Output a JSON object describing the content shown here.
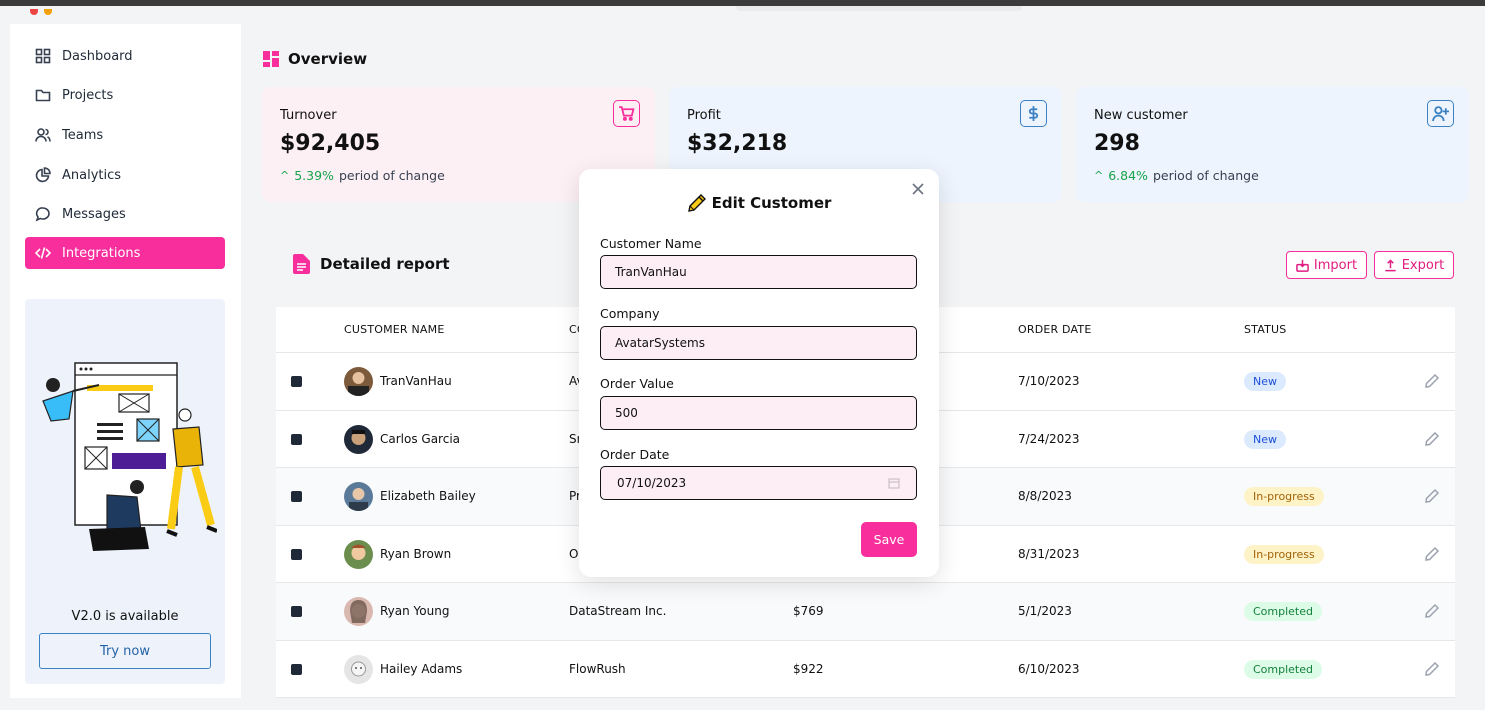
{
  "sidebar": {
    "items": [
      {
        "label": "Dashboard",
        "icon": "grid-icon"
      },
      {
        "label": "Projects",
        "icon": "folder-icon"
      },
      {
        "label": "Teams",
        "icon": "users-icon"
      },
      {
        "label": "Analytics",
        "icon": "pie-chart-icon"
      },
      {
        "label": "Messages",
        "icon": "chat-icon"
      },
      {
        "label": "Integrations",
        "icon": "code-icon",
        "active": true
      }
    ],
    "promo": {
      "text": "V2.0 is available",
      "button": "Try now"
    }
  },
  "overview": {
    "title": "Overview",
    "cards": [
      {
        "label": "Turnover",
        "value": "$92,405",
        "change": "5.39%",
        "change_text": "period of change",
        "icon": "cart-icon",
        "bg": "#fdf0f5",
        "accent": "#f72e9b"
      },
      {
        "label": "Profit",
        "value": "$32,218",
        "change": "",
        "change_text": "",
        "icon": "dollar-icon",
        "bg": "#eef4fd",
        "accent": "#3b82c4"
      },
      {
        "label": "New customer",
        "value": "298",
        "change": "6.84%",
        "change_text": "period of change",
        "icon": "user-plus-icon",
        "bg": "#eef4fd",
        "accent": "#3b82c4"
      }
    ]
  },
  "report": {
    "title": "Detailed report",
    "import_label": "Import",
    "export_label": "Export",
    "columns": [
      "CUSTOMER NAME",
      "CO",
      "ORDER DATE",
      "STATUS"
    ],
    "rows": [
      {
        "name": "TranVanHau",
        "company": "Av",
        "value": "",
        "date": "7/10/2023",
        "status": "New"
      },
      {
        "name": "Carlos Garcia",
        "company": "Sn",
        "value": "",
        "date": "7/24/2023",
        "status": "New"
      },
      {
        "name": "Elizabeth Bailey",
        "company": "Pr",
        "value": "",
        "date": "8/8/2023",
        "status": "In-progress"
      },
      {
        "name": "Ryan Brown",
        "company": "O",
        "value": "",
        "date": "8/31/2023",
        "status": "In-progress"
      },
      {
        "name": "Ryan Young",
        "company": "DataStream Inc.",
        "value": "$769",
        "date": "5/1/2023",
        "status": "Completed"
      },
      {
        "name": "Hailey Adams",
        "company": "FlowRush",
        "value": "$922",
        "date": "6/10/2023",
        "status": "Completed"
      }
    ]
  },
  "modal": {
    "title": "Edit Customer",
    "fields": {
      "name_label": "Customer Name",
      "name_value": "TranVanHau",
      "company_label": "Company",
      "company_value": "AvatarSystems",
      "value_label": "Order Value",
      "value_value": "500",
      "date_label": "Order Date",
      "date_value": "07/10/2023"
    },
    "save_label": "Save"
  },
  "colors": {
    "accent": "#f72e9b",
    "blue": "#3b82c4",
    "green": "#16a34a"
  }
}
